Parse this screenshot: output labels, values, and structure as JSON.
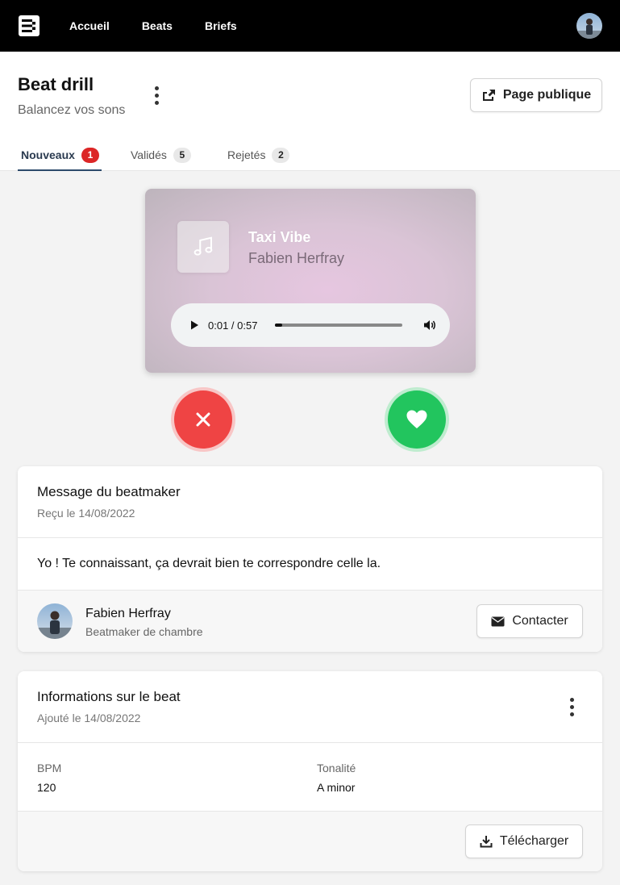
{
  "nav": {
    "items": [
      {
        "label": "Accueil"
      },
      {
        "label": "Beats"
      },
      {
        "label": "Briefs"
      }
    ]
  },
  "header": {
    "title": "Beat drill",
    "subtitle": "Balancez vos sons",
    "public_button": "Page publique",
    "tabs": [
      {
        "label": "Nouveaux",
        "count": "1"
      },
      {
        "label": "Validés",
        "count": "5"
      },
      {
        "label": "Rejetés",
        "count": "2"
      }
    ]
  },
  "player": {
    "title": "Taxi Vibe",
    "artist": "Fabien Herfray",
    "time": "0:01 / 0:57",
    "progress": 0.06
  },
  "message_card": {
    "title": "Message du beatmaker",
    "received": "Reçu le 14/08/2022",
    "message": "Yo ! Te connaissant, ça devrait bien te correspondre celle la.",
    "beatmaker_name": "Fabien Herfray",
    "beatmaker_role": "Beatmaker de chambre",
    "contact_button": "Contacter"
  },
  "info_card": {
    "title": "Informations sur le beat",
    "added": "Ajouté le 14/08/2022",
    "bpm_label": "BPM",
    "bpm_value": "120",
    "key_label": "Tonalité",
    "key_value": "A minor",
    "download_button": "Télécharger"
  },
  "colors": {
    "topbar": "#000000",
    "reject": "#ef4444",
    "like": "#22c55e",
    "badge_red": "#dc2626",
    "active_tab": "#2c4a6b"
  },
  "icons": {
    "logo": "brand-logo-icon",
    "share": "share-icon",
    "music": "music-note-icon",
    "play": "play-icon",
    "volume": "volume-icon",
    "reject": "close-icon",
    "like": "heart-icon",
    "mail": "envelope-icon",
    "download": "download-icon",
    "more": "kebab-icon"
  }
}
